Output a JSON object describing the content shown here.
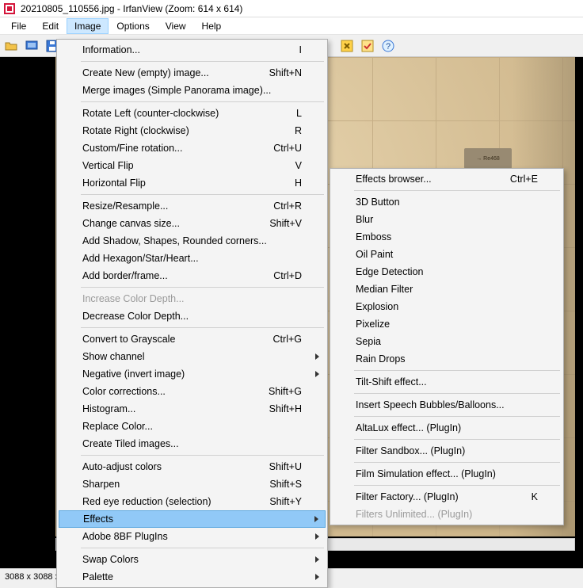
{
  "title": "20210805_110556.jpg - IrfanView (Zoom: 614 x 614)",
  "menubar": [
    "File",
    "Edit",
    "Image",
    "Options",
    "View",
    "Help"
  ],
  "active_menu_index": 2,
  "status_left": "3088 x 3088 x",
  "sign_text": "→ Re468",
  "image_menu": [
    {
      "t": "item",
      "label": "Information...",
      "accel": "I"
    },
    {
      "t": "sep"
    },
    {
      "t": "item",
      "label": "Create New (empty) image...",
      "accel": "Shift+N"
    },
    {
      "t": "item",
      "label": "Merge images (Simple Panorama image)..."
    },
    {
      "t": "sep"
    },
    {
      "t": "item",
      "label": "Rotate Left (counter-clockwise)",
      "accel": "L"
    },
    {
      "t": "item",
      "label": "Rotate Right (clockwise)",
      "accel": "R"
    },
    {
      "t": "item",
      "label": "Custom/Fine rotation...",
      "accel": "Ctrl+U"
    },
    {
      "t": "item",
      "label": "Vertical Flip",
      "accel": "V"
    },
    {
      "t": "item",
      "label": "Horizontal Flip",
      "accel": "H"
    },
    {
      "t": "sep"
    },
    {
      "t": "item",
      "label": "Resize/Resample...",
      "accel": "Ctrl+R"
    },
    {
      "t": "item",
      "label": "Change canvas size...",
      "accel": "Shift+V"
    },
    {
      "t": "item",
      "label": "Add Shadow, Shapes, Rounded corners..."
    },
    {
      "t": "item",
      "label": "Add Hexagon/Star/Heart..."
    },
    {
      "t": "item",
      "label": "Add border/frame...",
      "accel": "Ctrl+D"
    },
    {
      "t": "sep"
    },
    {
      "t": "item",
      "label": "Increase Color Depth...",
      "disabled": true
    },
    {
      "t": "item",
      "label": "Decrease Color Depth..."
    },
    {
      "t": "sep"
    },
    {
      "t": "item",
      "label": "Convert to Grayscale",
      "accel": "Ctrl+G"
    },
    {
      "t": "item",
      "label": "Show channel",
      "sub": true
    },
    {
      "t": "item",
      "label": "Negative (invert image)",
      "sub": true
    },
    {
      "t": "item",
      "label": "Color corrections...",
      "accel": "Shift+G"
    },
    {
      "t": "item",
      "label": "Histogram...",
      "accel": "Shift+H"
    },
    {
      "t": "item",
      "label": "Replace Color..."
    },
    {
      "t": "item",
      "label": "Create Tiled images..."
    },
    {
      "t": "sep"
    },
    {
      "t": "item",
      "label": "Auto-adjust colors",
      "accel": "Shift+U"
    },
    {
      "t": "item",
      "label": "Sharpen",
      "accel": "Shift+S"
    },
    {
      "t": "item",
      "label": "Red eye reduction (selection)",
      "accel": "Shift+Y"
    },
    {
      "t": "item",
      "label": "Effects",
      "sub": true,
      "highlight": true
    },
    {
      "t": "item",
      "label": "Adobe 8BF PlugIns",
      "sub": true
    },
    {
      "t": "sep"
    },
    {
      "t": "item",
      "label": "Swap Colors",
      "sub": true
    },
    {
      "t": "item",
      "label": "Palette",
      "sub": true
    }
  ],
  "effects_menu": [
    {
      "t": "item",
      "label": "Effects browser...",
      "accel": "Ctrl+E"
    },
    {
      "t": "sep"
    },
    {
      "t": "item",
      "label": "3D Button"
    },
    {
      "t": "item",
      "label": "Blur"
    },
    {
      "t": "item",
      "label": "Emboss"
    },
    {
      "t": "item",
      "label": "Oil Paint"
    },
    {
      "t": "item",
      "label": "Edge Detection"
    },
    {
      "t": "item",
      "label": "Median Filter"
    },
    {
      "t": "item",
      "label": "Explosion"
    },
    {
      "t": "item",
      "label": "Pixelize"
    },
    {
      "t": "item",
      "label": "Sepia"
    },
    {
      "t": "item",
      "label": "Rain Drops"
    },
    {
      "t": "sep"
    },
    {
      "t": "item",
      "label": "Tilt-Shift effect..."
    },
    {
      "t": "sep"
    },
    {
      "t": "item",
      "label": "Insert Speech Bubbles/Balloons..."
    },
    {
      "t": "sep"
    },
    {
      "t": "item",
      "label": "AltaLux effect... (PlugIn)"
    },
    {
      "t": "sep"
    },
    {
      "t": "item",
      "label": "Filter Sandbox... (PlugIn)"
    },
    {
      "t": "sep"
    },
    {
      "t": "item",
      "label": "Film Simulation effect... (PlugIn)"
    },
    {
      "t": "sep"
    },
    {
      "t": "item",
      "label": "Filter Factory... (PlugIn)",
      "accel": "K"
    },
    {
      "t": "item",
      "label": "Filters Unlimited... (PlugIn)",
      "disabled": true
    }
  ]
}
